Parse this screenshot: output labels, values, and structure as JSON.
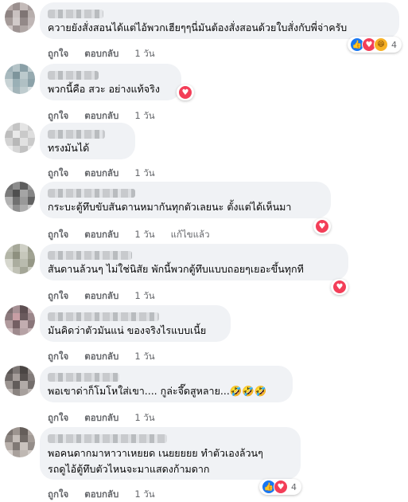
{
  "actions": {
    "like": "ถูกใจ",
    "reply": "ตอบกลับ",
    "edited": "แก้ไขแล้ว"
  },
  "comments": [
    {
      "text": [
        "ควายยังสั่งสอนได้แต่ไอ้พวกเฮียๆๆนี่มันต้องสั่งสอนด้วยใบสั่งกับพี่จ่าครับ"
      ],
      "time": "1 วัน",
      "reactions": [
        "like",
        "love",
        "haha"
      ],
      "reaction_count": "4"
    },
    {
      "text": [
        "พวกนี้คือ สวะ อย่างแท้จริง"
      ],
      "time": "1 วัน",
      "reactions": [
        "love"
      ]
    },
    {
      "text": [
        "ทรงมันได้"
      ],
      "time": "1 วัน",
      "reactions": []
    },
    {
      "text": [
        "กระบะตู้ทึบขับสันดานหมากันทุกตัวเลยนะ ตั้งแต่ได้เห็นมา"
      ],
      "time": "1 วัน",
      "edited": true,
      "reactions": [
        "love"
      ]
    },
    {
      "text": [
        "สันดานล้วนๆ ไม่ใช่นิสัย พักนี้พวกตู้ทึบแบบถอยๆเยอะขึ้นทุกที"
      ],
      "time": "1 วัน",
      "reactions": [
        "love"
      ]
    },
    {
      "text": [
        "มันคิดว่าตัวมันแน่ ของจริงไรแบบเนี้ย"
      ],
      "time": "1 วัน",
      "reactions": []
    },
    {
      "text": [
        "พอเขาด่าก็โมโหใส่เขา.... กูล่ะจึ๊ดสูหลาย...🤣🤣🤣"
      ],
      "time": "1 วัน",
      "reactions": []
    },
    {
      "text": [
        "พอคนดากมาหาวาเหยยด เนยยยยย ทำตัวเองล้วนๆ",
        "รถดูไอ้ตู้ทึบตัวไหนจะมาแสดงก้ามดาก"
      ],
      "time": "1 วัน",
      "reactions": [
        "like",
        "love"
      ],
      "reaction_count": "4"
    }
  ],
  "colors": {
    "bubble": "#f0f2f5",
    "action_text": "#65676b",
    "like": "#1877f2",
    "love": "#f33e58",
    "haha": "#f7b125"
  },
  "icons": {
    "like": "thumbs-up-icon",
    "love": "heart-icon",
    "haha": "laughing-face-icon"
  }
}
